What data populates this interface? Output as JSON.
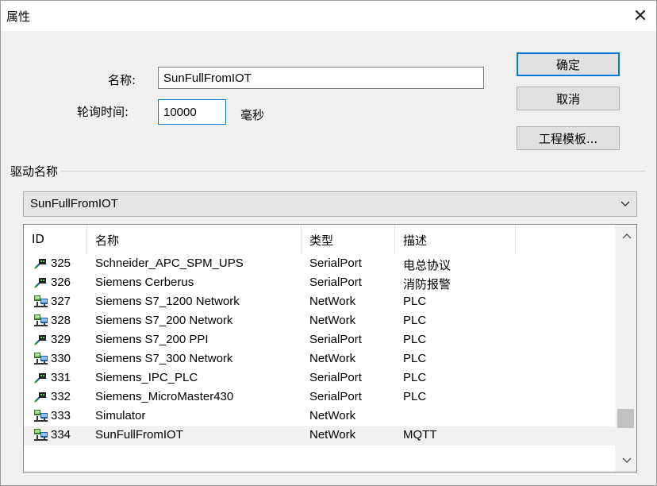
{
  "title": "属性",
  "fields": {
    "name_label": "名称:",
    "name_value": "SunFullFromIOT",
    "interval_label": "轮询时间:",
    "interval_value": "10000",
    "interval_unit": "毫秒"
  },
  "buttons": {
    "ok": "确定",
    "cancel": "取消",
    "template": "工程模板..."
  },
  "driver_group": {
    "label": "驱动名称",
    "selected": "SunFullFromIOT"
  },
  "list": {
    "columns": [
      "ID",
      "名称",
      "类型",
      "描述"
    ],
    "rows": [
      {
        "icon": "serial-icon",
        "id": "325",
        "name": "Schneider_APC_SPM_UPS",
        "type": "SerialPort",
        "desc": "电总协议"
      },
      {
        "icon": "serial-icon",
        "id": "326",
        "name": "Siemens Cerberus",
        "type": "SerialPort",
        "desc": "消防报警"
      },
      {
        "icon": "network-icon",
        "id": "327",
        "name": "Siemens S7_1200 Network",
        "type": "NetWork",
        "desc": "PLC"
      },
      {
        "icon": "network-icon",
        "id": "328",
        "name": "Siemens S7_200 Network",
        "type": "NetWork",
        "desc": "PLC"
      },
      {
        "icon": "serial-icon",
        "id": "329",
        "name": "Siemens S7_200 PPI",
        "type": "SerialPort",
        "desc": "PLC"
      },
      {
        "icon": "network-icon",
        "id": "330",
        "name": "Siemens S7_300 Network",
        "type": "NetWork",
        "desc": "PLC"
      },
      {
        "icon": "serial-icon",
        "id": "331",
        "name": "Siemens_IPC_PLC",
        "type": "SerialPort",
        "desc": "PLC"
      },
      {
        "icon": "serial-icon",
        "id": "332",
        "name": "Siemens_MicroMaster430",
        "type": "SerialPort",
        "desc": "PLC"
      },
      {
        "icon": "network-icon",
        "id": "333",
        "name": "Simulator",
        "type": "NetWork",
        "desc": ""
      },
      {
        "icon": "network-icon",
        "id": "334",
        "name": "SunFullFromIOT",
        "type": "NetWork",
        "desc": "MQTT",
        "selected": true
      }
    ]
  },
  "colors": {
    "focus_border": "#0078d7",
    "selected_row": "#f0f0f0"
  }
}
